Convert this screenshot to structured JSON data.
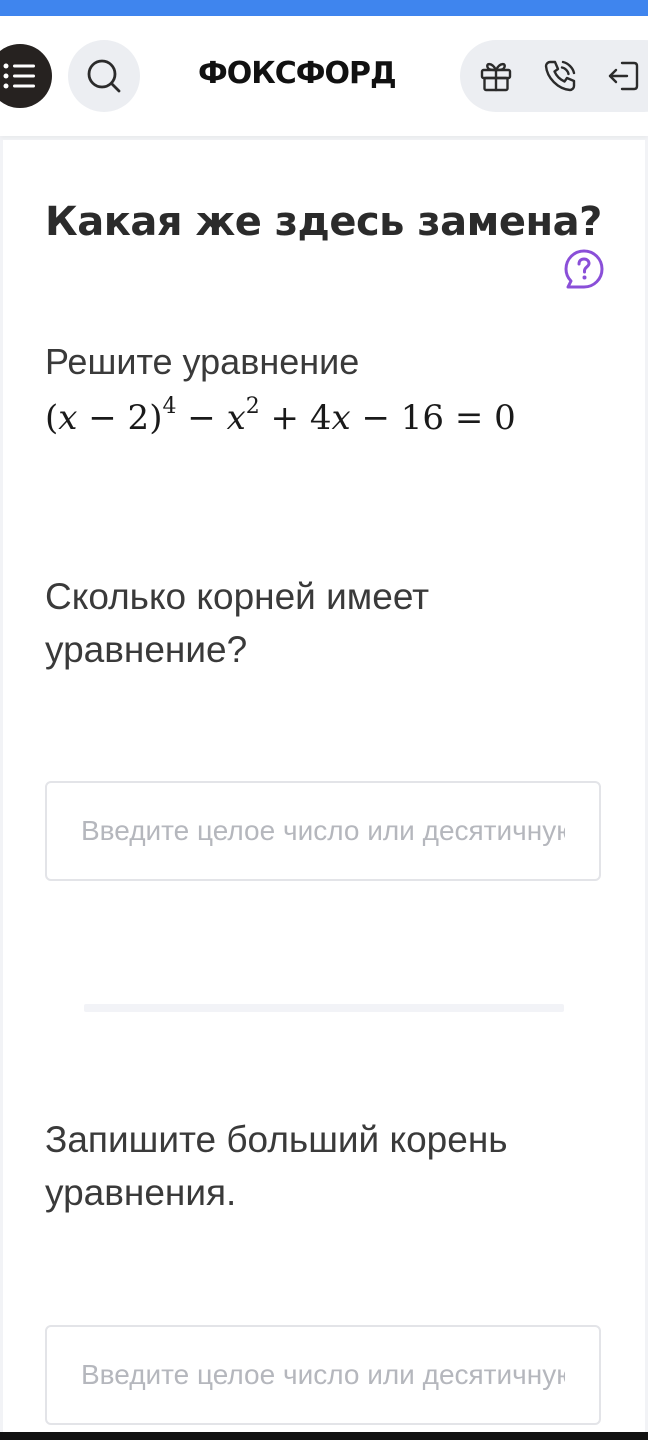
{
  "header": {
    "logo_text": "ФОКСФОРД",
    "menu_icon": "list-icon",
    "search_icon": "search-icon",
    "gift_icon": "gift-icon",
    "phone_icon": "phone-icon",
    "logout_icon": "logout-icon"
  },
  "task": {
    "title": "Какая же здесь замена?",
    "help_icon": "help-icon",
    "instruction": "Решите уравнение",
    "equation": {
      "base_open": "(",
      "var1": "x",
      "minus_two": " − 2)",
      "exp1": "4",
      "minus": " − ",
      "var2": "x",
      "exp2": "2",
      "plus_four": " + 4",
      "var3": "x",
      "rest": " − 16 = 0"
    }
  },
  "questions": [
    {
      "text": "Сколько корней имеет уравнение?",
      "input_placeholder": "Введите целое число или десятичную дробь",
      "input_value": ""
    },
    {
      "text": "Запишите больший корень уравнения.",
      "input_placeholder": "Введите целое число или десятичную дробь",
      "input_value": ""
    }
  ],
  "colors": {
    "accent_bar": "#3f85ee",
    "help_icon": "#8a4fd8",
    "menu_button": "#262220"
  }
}
